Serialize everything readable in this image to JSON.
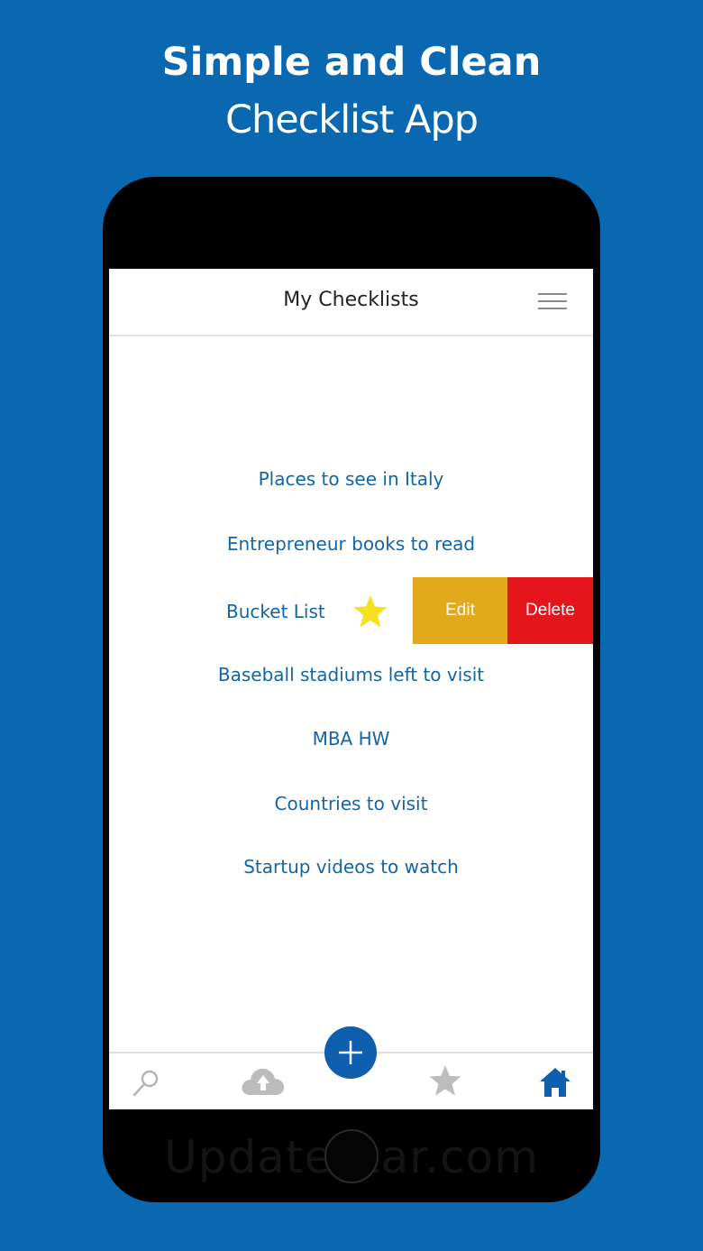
{
  "promo": {
    "title": "Simple and Clean",
    "subtitle": "Checklist App"
  },
  "header": {
    "title": "My Checklists",
    "menu_icon": "hamburger-menu-icon"
  },
  "checklists": [
    {
      "label": "Places to see in Italy"
    },
    {
      "label": "Entrepreneur books to read"
    },
    {
      "label": "Bucket List",
      "favorite": true
    },
    {
      "label": "Baseball stadiums left to visit"
    },
    {
      "label": "MBA HW"
    },
    {
      "label": "Countries to visit"
    },
    {
      "label": "Startup videos to watch"
    }
  ],
  "swipe_actions": {
    "edit_label": "Edit",
    "delete_label": "Delete",
    "edit_color": "#e3a81b",
    "delete_color": "#e5151c"
  },
  "tab_bar": {
    "tabs": [
      {
        "icon": "search-icon",
        "active": false
      },
      {
        "icon": "cloud-upload-icon",
        "active": false
      },
      {
        "icon": "star-icon",
        "active": false
      },
      {
        "icon": "home-icon",
        "active": true
      }
    ],
    "add_button_icon": "plus-icon"
  },
  "watermark": "UpdateStar.com",
  "colors": {
    "background": "#0a68b1",
    "link_text": "#1266a8",
    "active_tab": "#0f5fae",
    "inactive_tab": "#bdbdbd"
  }
}
